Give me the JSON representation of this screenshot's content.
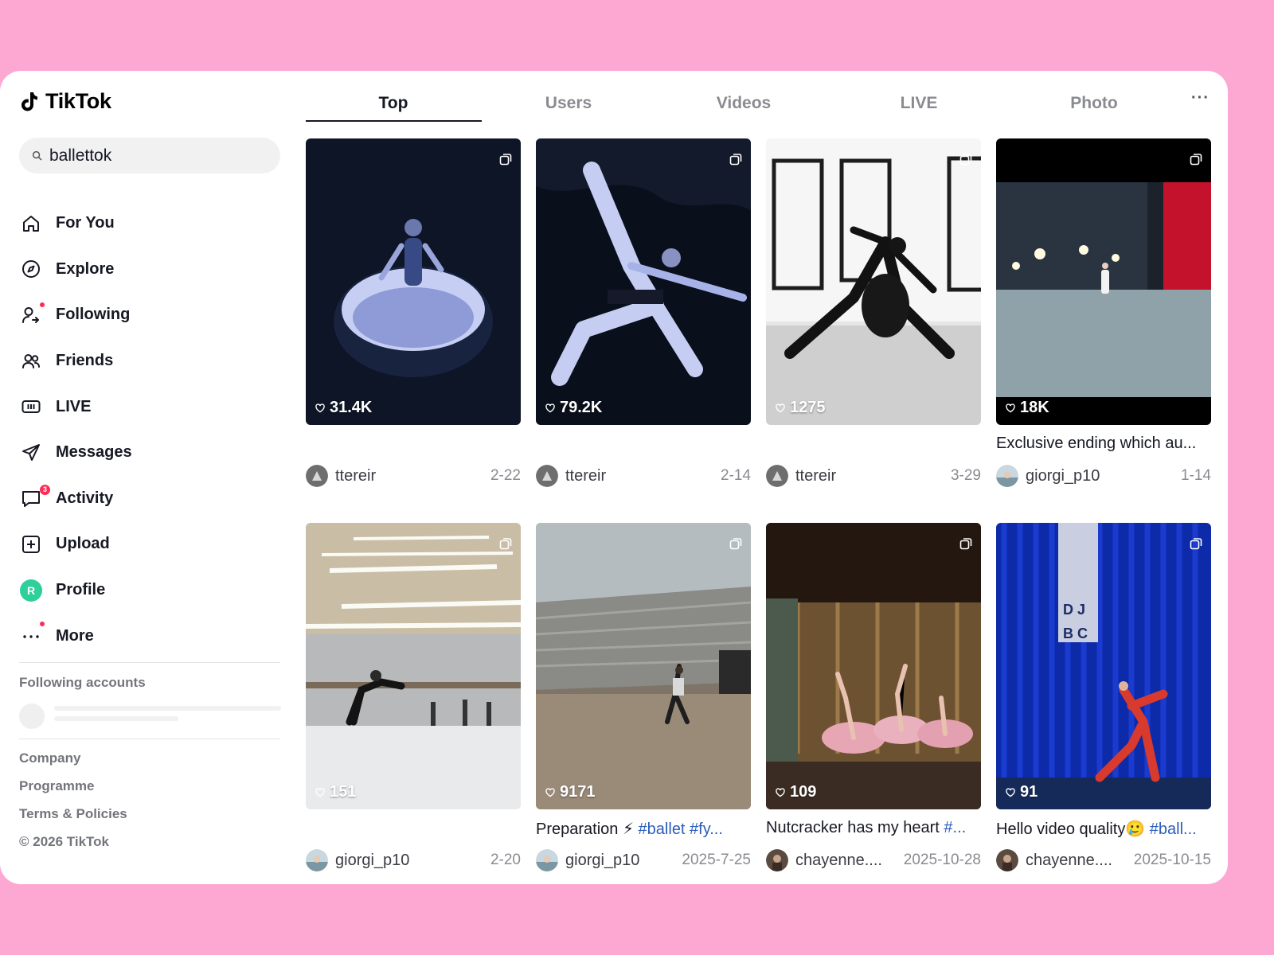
{
  "app": {
    "name": "TikTok"
  },
  "search": {
    "value": "ballettok"
  },
  "nav": [
    {
      "label": "For You",
      "icon": "home-icon"
    },
    {
      "label": "Explore",
      "icon": "compass-icon"
    },
    {
      "label": "Following",
      "icon": "following-icon"
    },
    {
      "label": "Friends",
      "icon": "friends-icon"
    },
    {
      "label": "LIVE",
      "icon": "live-icon"
    },
    {
      "label": "Messages",
      "icon": "send-icon"
    },
    {
      "label": "Activity",
      "icon": "inbox-icon",
      "badge": "3"
    },
    {
      "label": "Upload",
      "icon": "upload-icon"
    },
    {
      "label": "Profile",
      "icon": "avatar",
      "avatar_letter": "R"
    },
    {
      "label": "More",
      "icon": "more-icon"
    }
  ],
  "following_accounts_title": "Following accounts",
  "footer": [
    "Company",
    "Programme",
    "Terms & Policies",
    "© 2026 TikTok"
  ],
  "tabs": [
    "Top",
    "Users",
    "Videos",
    "LIVE",
    "Photo"
  ],
  "active_tab": "Top",
  "tab_more": "···",
  "videos": [
    {
      "likes": "31.4K",
      "caption": "",
      "user": "ttereir",
      "date": "2-22"
    },
    {
      "likes": "79.2K",
      "caption": "",
      "user": "ttereir",
      "date": "2-14"
    },
    {
      "likes": "1275",
      "caption": "",
      "user": "ttereir",
      "date": "3-29"
    },
    {
      "likes": "18K",
      "caption": "Exclusive ending which au...",
      "user": "giorgi_p10",
      "date": "1-14"
    },
    {
      "likes": "151",
      "caption": "",
      "user": "giorgi_p10",
      "date": "2-20"
    },
    {
      "likes": "9171",
      "caption": "Preparation ⚡",
      "caption_tags": " #ballet #fy...",
      "user": "giorgi_p10",
      "date": "2025-7-25"
    },
    {
      "likes": "109",
      "caption": "Nutcracker has my heart ",
      "caption_tags": "#...",
      "user": "chayenne....",
      "date": "2025-10-28"
    },
    {
      "likes": "91",
      "caption": "Hello video quality🥲 ",
      "caption_tags": "#ball...",
      "user": "chayenne....",
      "date": "2025-10-15"
    }
  ],
  "colors": {
    "background": "#fda7d3",
    "accent": "#fe2c55",
    "hashtag": "#2b5db9",
    "profile_avatar": "#2dcf9a"
  }
}
